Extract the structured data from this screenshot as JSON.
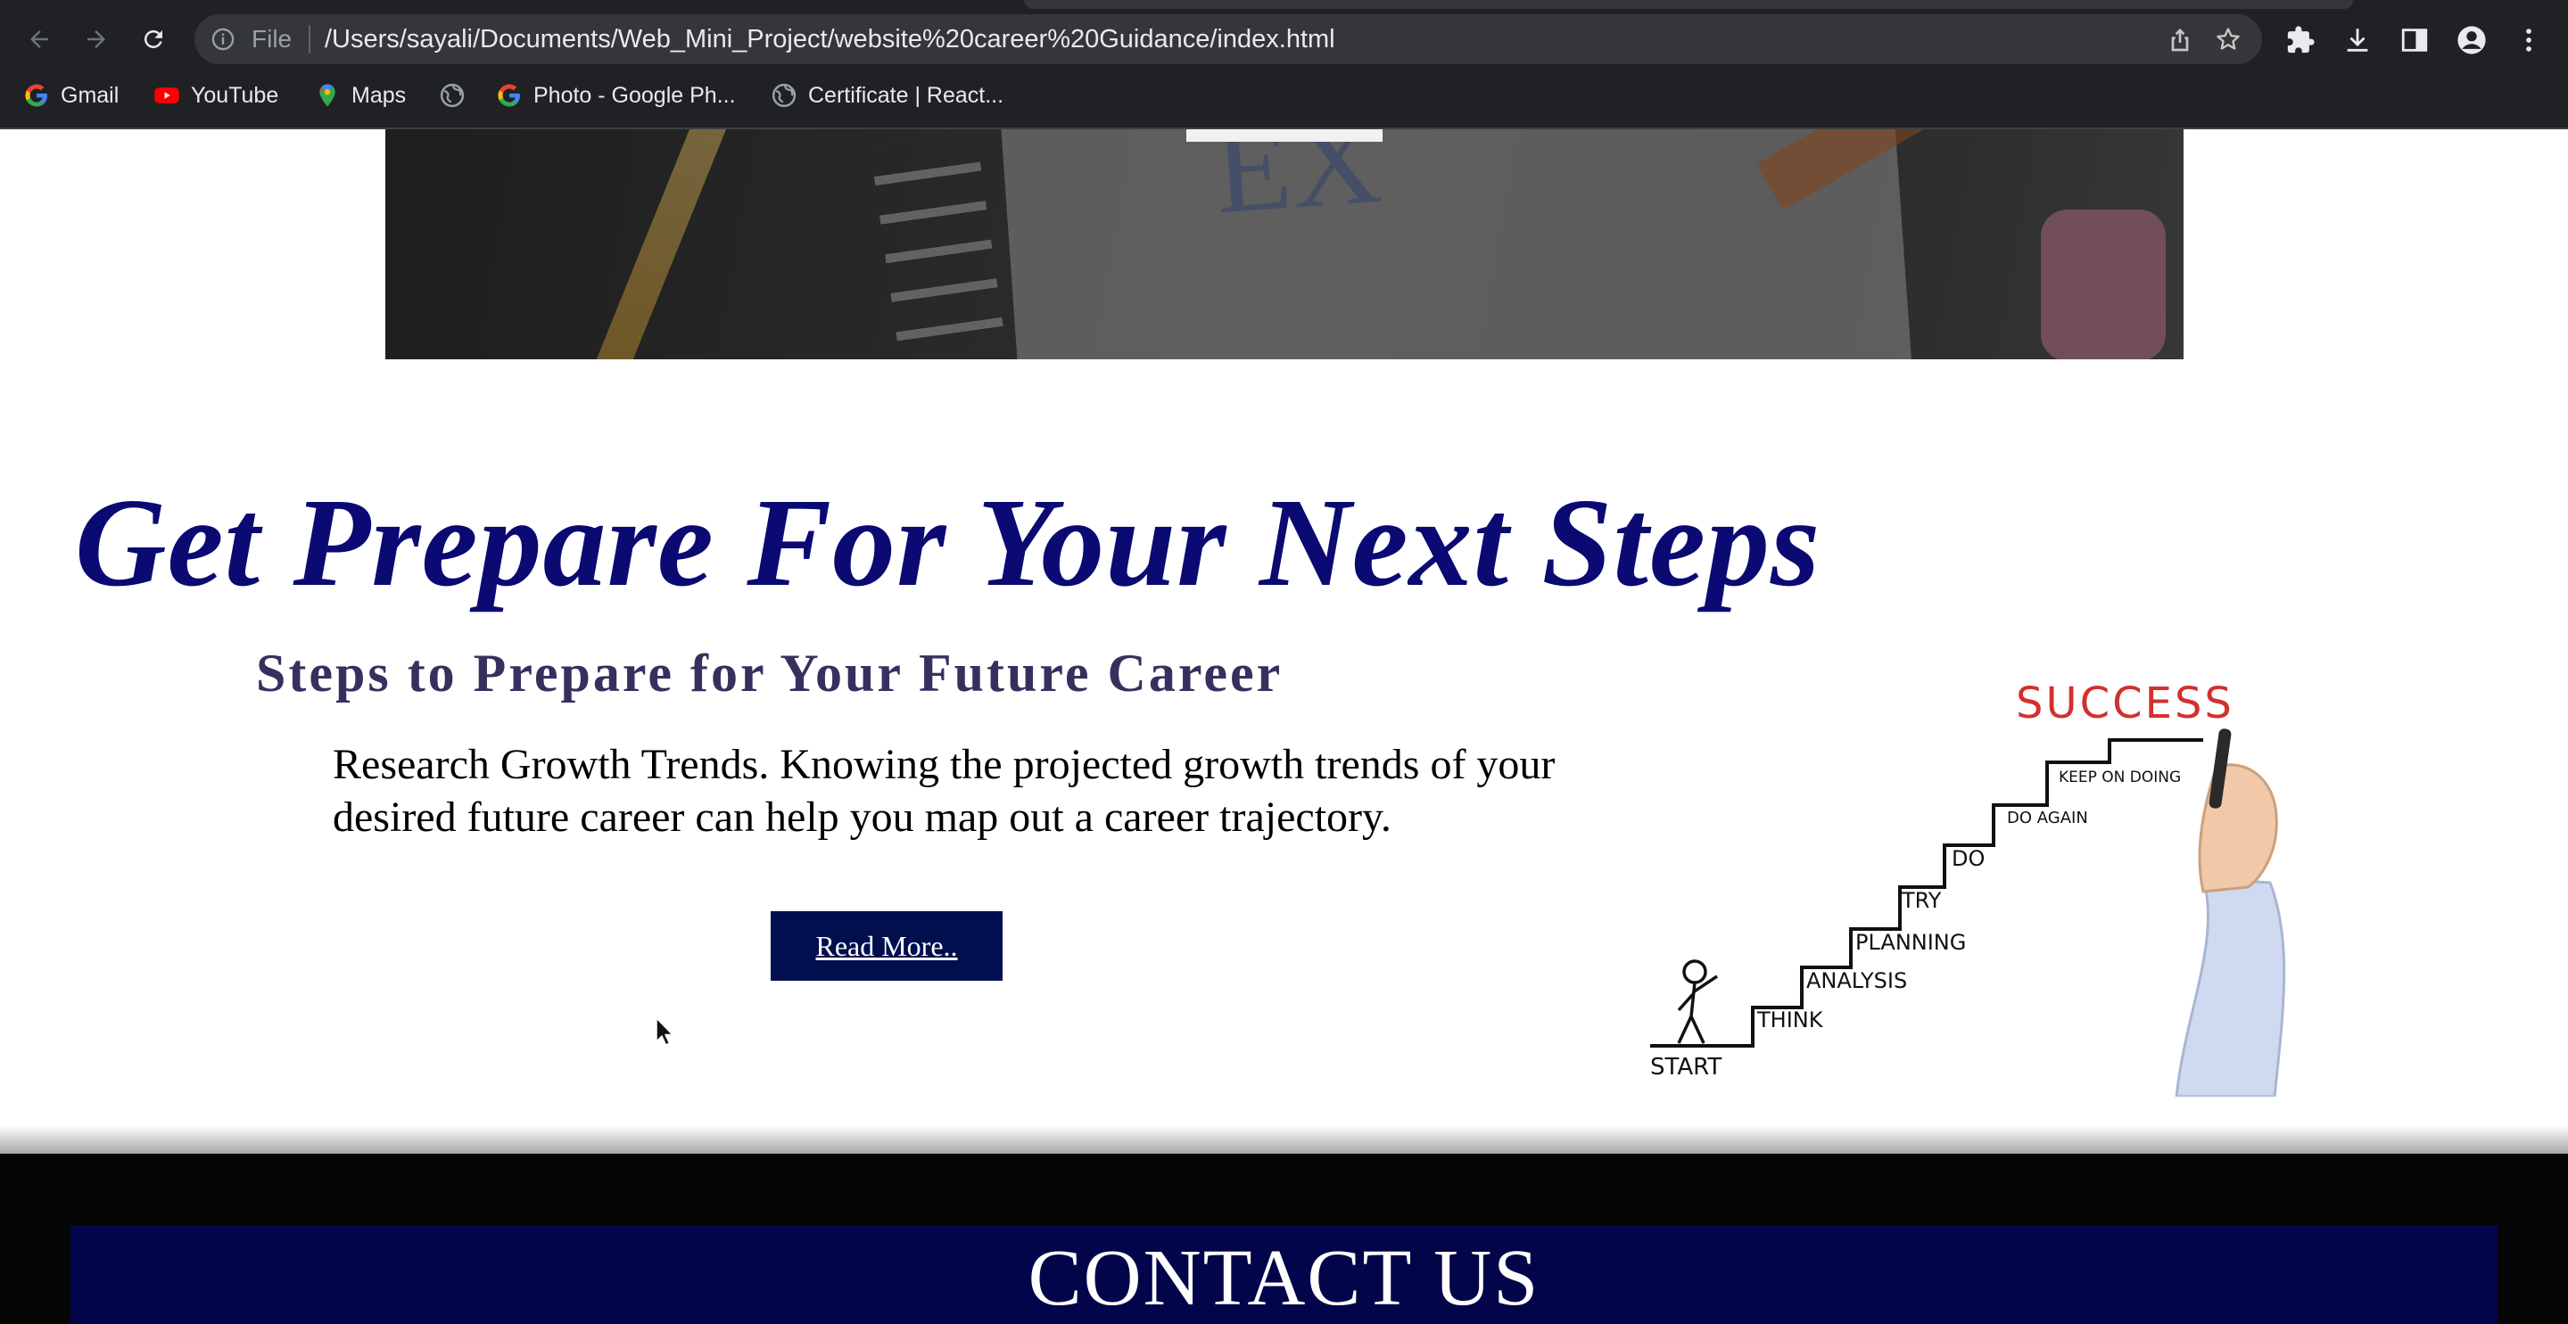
{
  "browser": {
    "file_label": "File",
    "url": "/Users/sayali/Documents/Web_Mini_Project/website%20career%20Guidance/index.html",
    "bookmarks": [
      {
        "label": "Gmail",
        "icon": "google-icon"
      },
      {
        "label": "YouTube",
        "icon": "youtube-icon"
      },
      {
        "label": "Maps",
        "icon": "maps-icon"
      },
      {
        "label": "",
        "icon": "globe-icon"
      },
      {
        "label": "Photo - Google Ph...",
        "icon": "google-icon"
      },
      {
        "label": "Certificate | React...",
        "icon": "globe-icon"
      }
    ]
  },
  "hero": {
    "image": "exam-notebook-pencils-photo"
  },
  "section": {
    "heading": "Get Prepare For Your Next Steps",
    "subheading": "Steps to Prepare for Your Future Career",
    "body": "Research Growth Trends. Knowing the projected growth trends of your desired future career can help you map out a career trajectory.",
    "button_label": "Read More..",
    "illustration": {
      "title": "SUCCESS",
      "steps": [
        "START",
        "THINK",
        "ANALYSIS",
        "PLANNING",
        "TRY",
        "DO",
        "DO AGAIN",
        "KEEP ON DOING"
      ]
    }
  },
  "footer": {
    "contact_title": "CONTACT US"
  },
  "colors": {
    "heading": "#0b0a73",
    "subheading": "#35315f",
    "button": "#020f4f",
    "contact_band": "#020549",
    "illustration_red": "#d32f2f"
  }
}
